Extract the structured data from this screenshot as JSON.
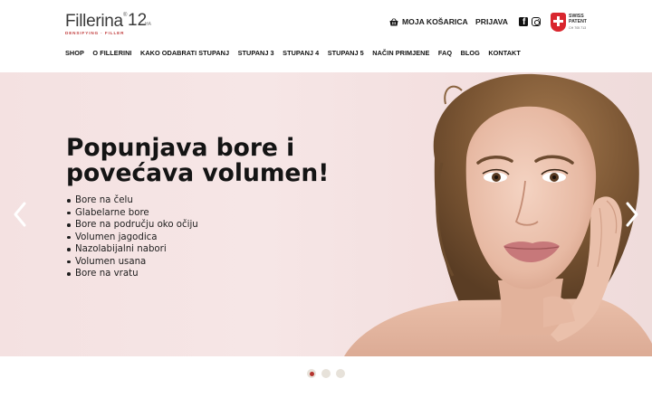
{
  "brand": {
    "logo_word": "Fillerina",
    "logo_reg": "®",
    "logo_number": "12",
    "logo_suffix": "HA",
    "logo_tagline": "DENSIFYING · FILLER",
    "accent_color": "#c03a3a"
  },
  "header": {
    "cart_label": "MOJA KOŠARICA",
    "cart_icon": "basket-icon",
    "login_label": "PRIJAVA",
    "social": [
      {
        "name": "facebook-icon"
      },
      {
        "name": "instagram-icon"
      }
    ],
    "badge": {
      "line1": "SWISS",
      "line2": "PATENT",
      "sub": "CH 705 713",
      "icon": "swiss-cross-icon",
      "color": "#d9262e"
    }
  },
  "nav": {
    "items": [
      "SHOP",
      "O FILLERINI",
      "KAKO ODABRATI STUPANJ",
      "STUPANJ 3",
      "STUPANJ 4",
      "STUPANJ 5",
      "NAČIN PRIMJENE",
      "FAQ",
      "BLOG",
      "KONTAKT"
    ]
  },
  "hero": {
    "title": "Popunjava bore i povećava volumen!",
    "bullets": [
      "Bore na čelu",
      "Glabelarne bore",
      "Bore na području oko očiju",
      "Volumen jagodica",
      "Nazolabijalni nabori",
      "Volumen usana",
      "Bore na vratu"
    ],
    "prev_icon": "chevron-left-icon",
    "next_icon": "chevron-right-icon",
    "background_color": "#f4e1e1"
  },
  "carousel": {
    "slide_count": 3,
    "active_index": 0,
    "active_color": "#b5332e"
  }
}
